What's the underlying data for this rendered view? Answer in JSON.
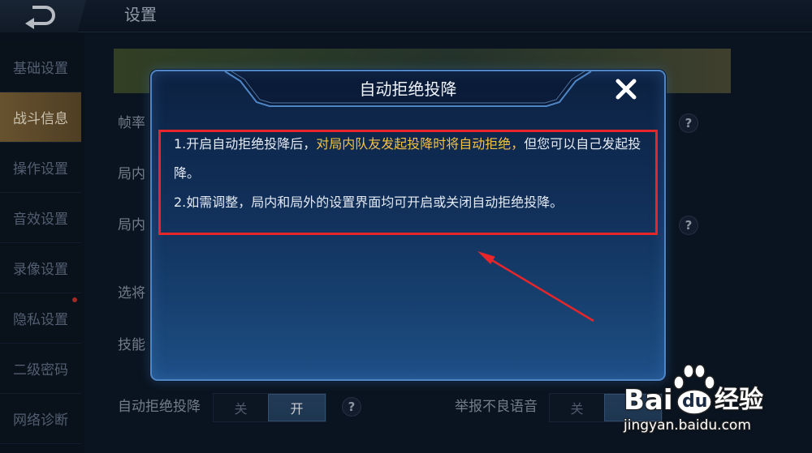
{
  "header": {
    "back_icon": "back-arrow-icon",
    "title": "设置"
  },
  "sidebar": {
    "items": [
      {
        "label": "基础设置",
        "selected": false
      },
      {
        "label": "战斗信息",
        "selected": true
      },
      {
        "label": "操作设置",
        "selected": false
      },
      {
        "label": "音效设置",
        "selected": false
      },
      {
        "label": "录像设置",
        "selected": false
      },
      {
        "label": "隐私设置",
        "selected": false,
        "notification_dot": true
      },
      {
        "label": "二级密码",
        "selected": false
      },
      {
        "label": "网络诊断",
        "selected": false
      }
    ]
  },
  "settings": {
    "rows": [
      {
        "label": "帧率",
        "help": "?"
      },
      {
        "label": "局内"
      },
      {
        "label": "局内",
        "help": "?"
      },
      {
        "label": "选将"
      },
      {
        "label": "技能"
      }
    ],
    "auto_reject_surrender": {
      "label": "自动拒绝投降",
      "off_label": "关",
      "on_label": "开",
      "enabled": true,
      "help": "?"
    },
    "report_voice": {
      "label": "举报不良语音",
      "off_label": "关",
      "enabled": true
    }
  },
  "modal": {
    "title": "自动拒绝投降",
    "close_icon": "close-icon",
    "item1_prefix": "1.开启自动拒绝投降后，",
    "item1_highlight": "对局内队友发起投降时将自动拒绝，",
    "item1_suffix": "但您可以自己发起投降。",
    "item2": "2.如需调整，局内和局外的设置界面均可开启或关闭自动拒绝投降。"
  },
  "watermark": {
    "logo_left": "Bai",
    "logo_icon": "baidu-paw-icon",
    "logo_right": "du",
    "product": "经验",
    "url": "jingyan.baidu.com"
  },
  "colors": {
    "highlight_text": "#f3c244",
    "annotation_red": "#e8262a",
    "selected_tab": "#7a6138",
    "modal_border": "#4f86c6",
    "toggle_on": "#23405f"
  }
}
